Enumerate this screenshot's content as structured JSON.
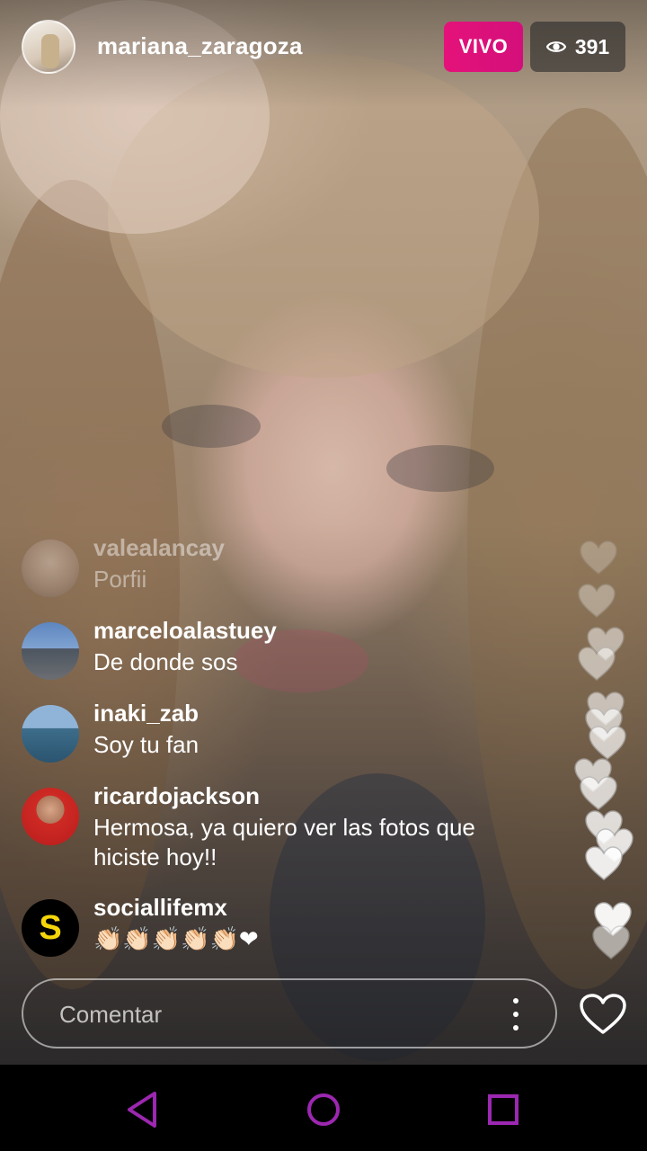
{
  "header": {
    "username": "mariana_zaragoza",
    "live_label": "VIVO",
    "viewer_count": "391"
  },
  "comments": [
    {
      "username": "valealancay",
      "text": "Porfii",
      "faded": true
    },
    {
      "username": "marceloalastuey",
      "text": "De donde sos"
    },
    {
      "username": "inaki_zab",
      "text": "Soy tu fan"
    },
    {
      "username": "ricardojackson",
      "text": "Hermosa, ya quiero ver las fotos que hiciste hoy!!"
    },
    {
      "username": "sociallifemx",
      "text": "👏🏻👏🏻👏🏻👏🏻👏🏻❤"
    }
  ],
  "comment_input": {
    "placeholder": "Comentar"
  },
  "colors": {
    "live_badge": "#E4127A",
    "nav_icons": "#9C27B0"
  },
  "icons": {
    "viewers": "eye-icon",
    "more": "more-vertical-icon",
    "like": "heart-outline-icon",
    "nav_back": "triangle-back-icon",
    "nav_home": "circle-home-icon",
    "nav_recents": "square-recents-icon"
  }
}
